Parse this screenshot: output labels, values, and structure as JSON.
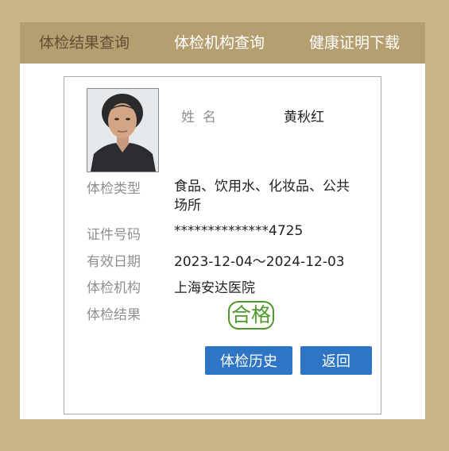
{
  "tabs": [
    {
      "label": "体检结果查询"
    },
    {
      "label": "体检机构查询"
    },
    {
      "label": "健康证明下载"
    }
  ],
  "card": {
    "name_label": "姓名",
    "name_value": "黄秋红",
    "fields": [
      {
        "label": "体检类型",
        "value": "食品、饮用水、化妆品、公共场所"
      },
      {
        "label": "证件号码",
        "value": "**************4725"
      },
      {
        "label": "有效日期",
        "value": "2023-12-04～2024-12-03"
      },
      {
        "label": "体检机构",
        "value": "上海安达医院"
      },
      {
        "label": "体检结果",
        "value": "合格"
      }
    ]
  },
  "buttons": {
    "history": "体检历史",
    "back": "返回"
  },
  "colors": {
    "page_bg": "#c9b585",
    "tab_bar": "#b59f71",
    "button": "#2f75c5",
    "stamp": "#4d9a2b"
  }
}
